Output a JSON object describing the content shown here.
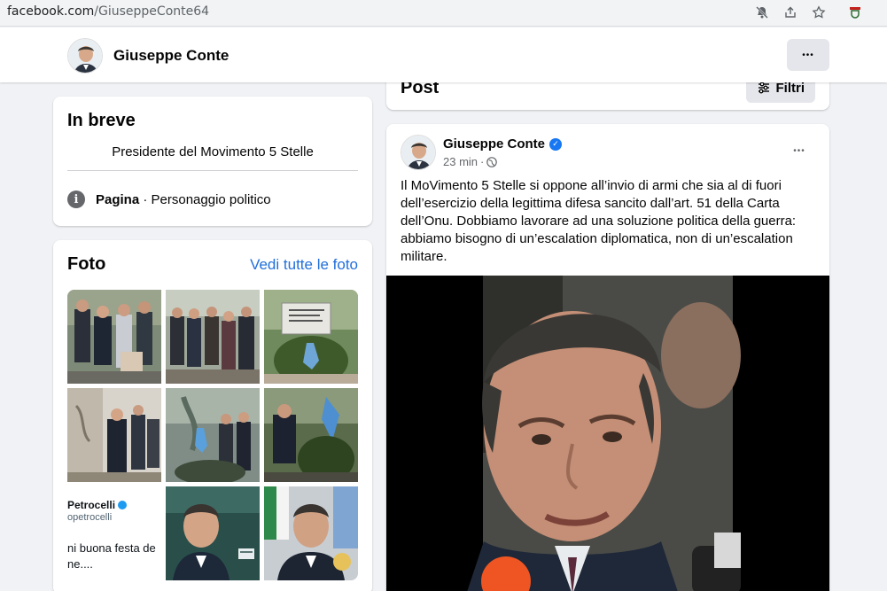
{
  "browser": {
    "url_host": "facebook.com",
    "url_path": "/GiuseppeConte64",
    "icons": [
      "mute-notifications-icon",
      "share-icon",
      "bookmark-star-icon",
      "extension-icon"
    ]
  },
  "header": {
    "page_name": "Giuseppe Conte",
    "more_label": "•••"
  },
  "intro": {
    "title": "In breve",
    "bio": "Presidente del Movimento 5 Stelle",
    "category_label": "Pagina",
    "category_sep": " · ",
    "category_value": "Personaggio politico"
  },
  "photos": {
    "title": "Foto",
    "see_all": "Vedi tutte le foto",
    "tile_texts": {
      "name": "Petrocelli",
      "handle": "opetrocelli",
      "line1": "ni buona festa de",
      "line2": "ne...."
    }
  },
  "posts": {
    "title": "Post",
    "filter_label": "Filtri"
  },
  "post": {
    "author": "Giuseppe Conte",
    "verified_mark": "✓",
    "time": "23 min",
    "dot": "·",
    "more_label": "•••",
    "text": "Il MoVimento 5 Stelle si oppone all’invio di armi che sia al di fuori dell’esercizio della legittima difesa sancito dall’art. 51 della Carta dell’Onu. Dobbiamo lavorare ad una soluzione politica della guerra: abbiamo bisogno di un’escalation diplomatica, non di un’escalation militare."
  },
  "colors": {
    "link": "#216fdb",
    "verified": "#1877f2",
    "page_bg": "#f0f2f5"
  }
}
